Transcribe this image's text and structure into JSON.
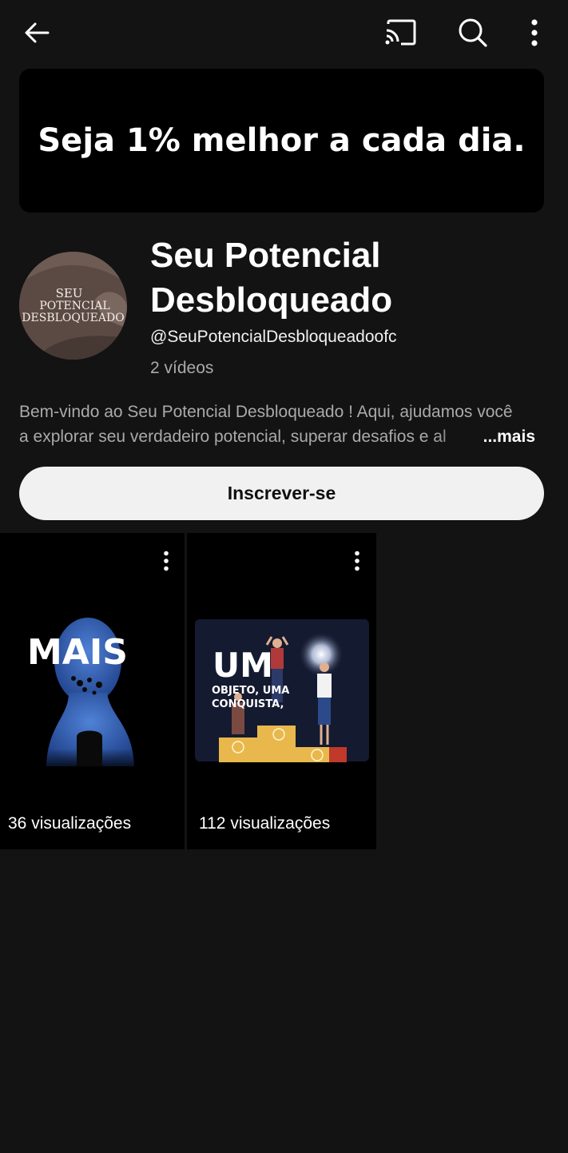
{
  "header": {
    "icons": [
      "back-arrow-icon",
      "cast-icon",
      "search-icon",
      "more-vertical-icon"
    ]
  },
  "banner": {
    "text": "Seja 1% melhor a cada dia."
  },
  "channel": {
    "avatar_text": [
      "SEU",
      "POTENCIAL",
      "DESBLOQUEADO"
    ],
    "name": "Seu Potencial Desbloqueado",
    "handle": "@SeuPotencialDesbloqueadoofc",
    "video_count": "2 vídeos",
    "description_line1": "Bem-vindo ao Seu Potencial Desbloqueado ! Aqui, ajudamos você",
    "description_line2": "a explorar seu verdadeiro potencial, superar desafios e al",
    "more_label": "...mais",
    "subscribe_label": "Inscrever-se"
  },
  "shorts": [
    {
      "thumbnail_title": "MAIS",
      "views": "36 visualizações"
    },
    {
      "thumbnail_title": "UM",
      "thumbnail_subtitle": "OBJETO, UMA CONQUISTA,",
      "views": "112 visualizações"
    }
  ],
  "colors": {
    "background": "#131313",
    "banner": "#000000",
    "subscribe_bg": "#f1f1f1",
    "secondary_text": "#aaaaaa"
  }
}
